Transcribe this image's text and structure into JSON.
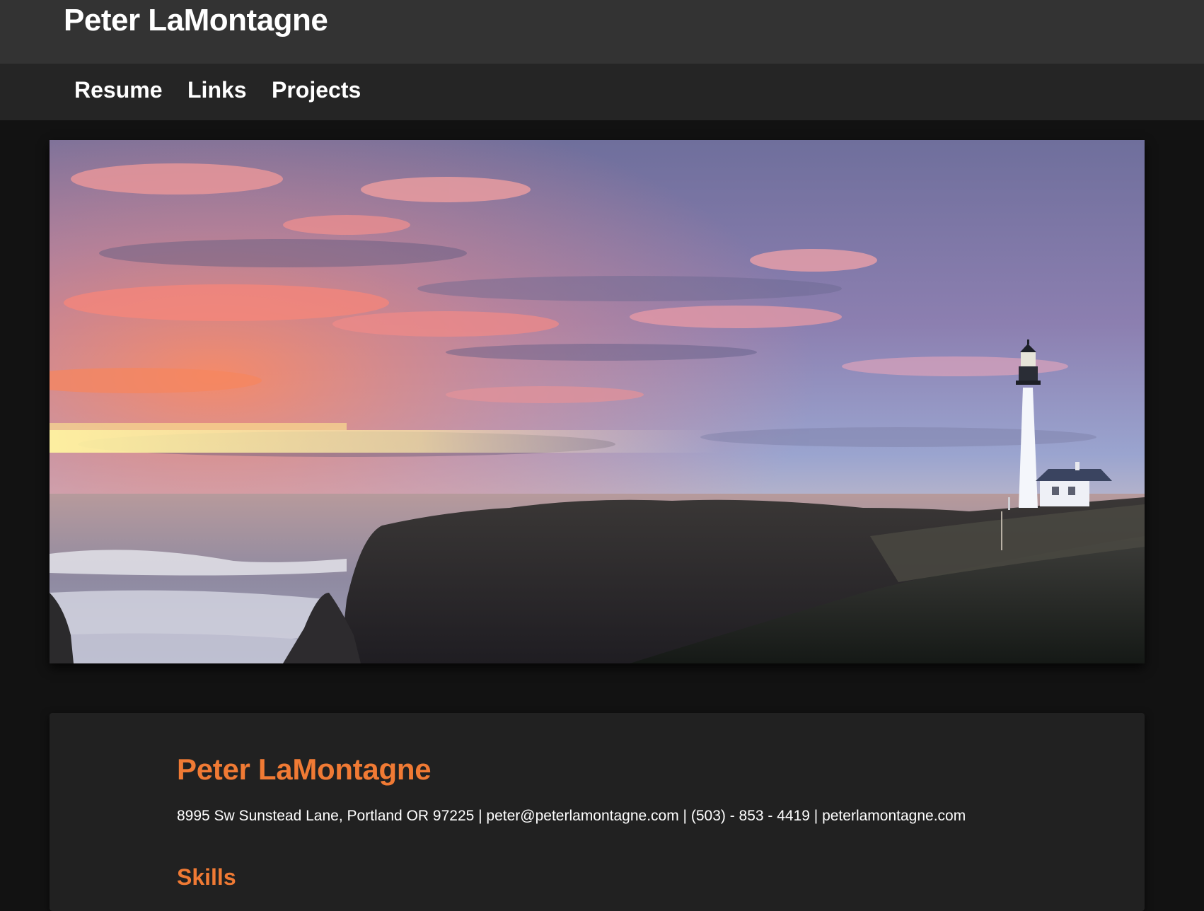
{
  "header": {
    "site_title": "Peter LaMontagne"
  },
  "nav": {
    "items": [
      {
        "label": "Resume"
      },
      {
        "label": "Links"
      },
      {
        "label": "Projects"
      }
    ]
  },
  "hero": {
    "description_icon": "landscape-photo"
  },
  "resume": {
    "name": "Peter LaMontagne",
    "contact": "8995 Sw Sunstead Lane, Portland OR 97225 | peter@peterlamontagne.com | (503) - 853 - 4419 | peterlamontagne.com",
    "sections": [
      {
        "heading": "Skills"
      }
    ]
  },
  "colors": {
    "accent": "#f07a34",
    "header_bg": "#333333",
    "nav_bg": "#252525",
    "page_bg": "#121212",
    "card_bg": "#212121"
  }
}
